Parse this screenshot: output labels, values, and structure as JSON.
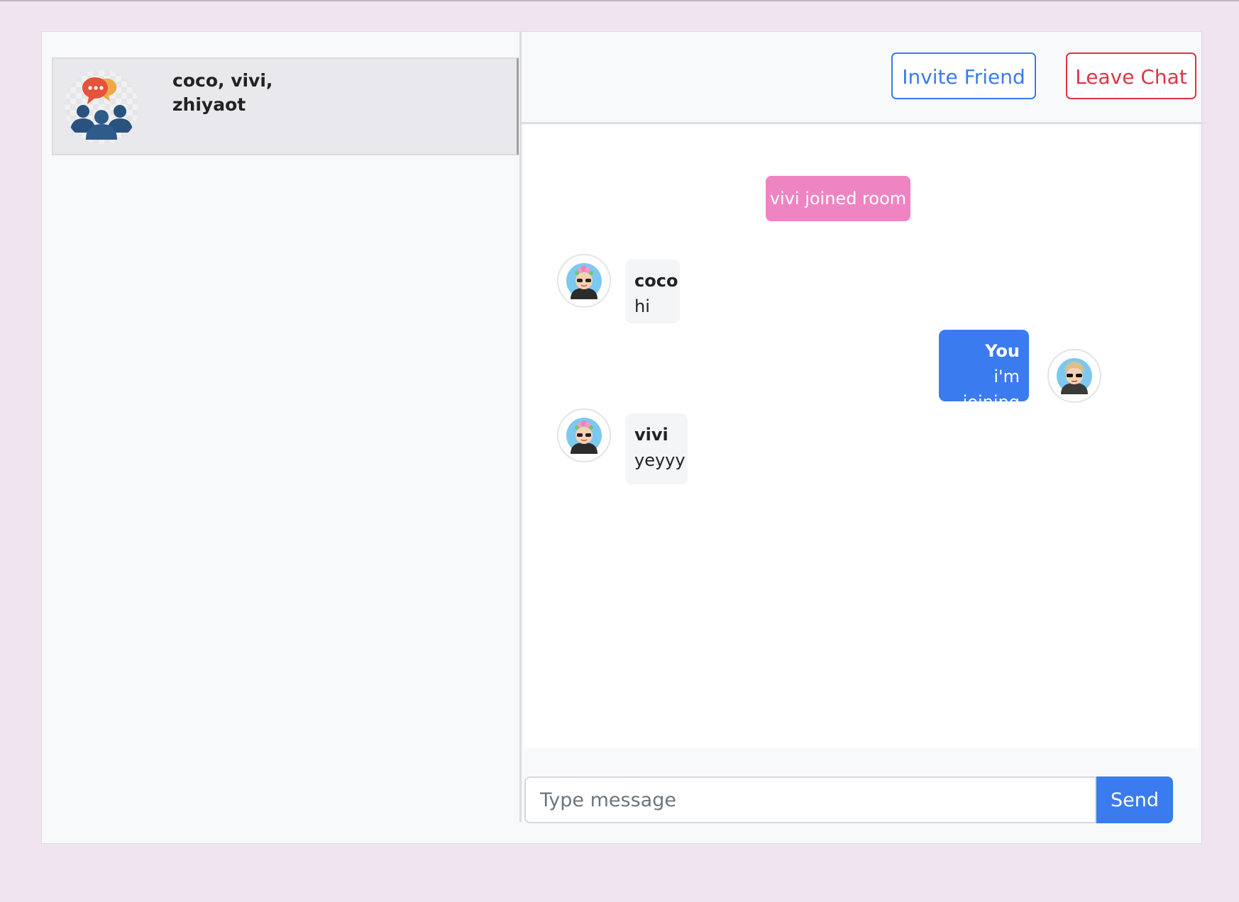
{
  "sidebar": {
    "rooms": [
      {
        "name": "coco, vivi, zhiyaot",
        "icon": "group-chat-icon"
      }
    ]
  },
  "header": {
    "invite_label": "Invite Friend",
    "leave_label": "Leave Chat"
  },
  "messages": {
    "system": "vivi joined room",
    "items": [
      {
        "sender": "coco",
        "text": "hi",
        "direction": "in",
        "avatar": "user-avatar-flower"
      },
      {
        "sender": "You",
        "text": "i'm joining",
        "direction": "out",
        "avatar": "user-avatar-sunglasses"
      },
      {
        "sender": "vivi",
        "text": "yeyyy",
        "direction": "in",
        "avatar": "user-avatar-flower"
      }
    ]
  },
  "composer": {
    "placeholder": "Type message",
    "value": "",
    "send_label": "Send"
  },
  "colors": {
    "background": "#f0e4f1",
    "primary": "#3a7bef",
    "danger": "#dc3545",
    "system_bubble": "#ef84c3"
  }
}
